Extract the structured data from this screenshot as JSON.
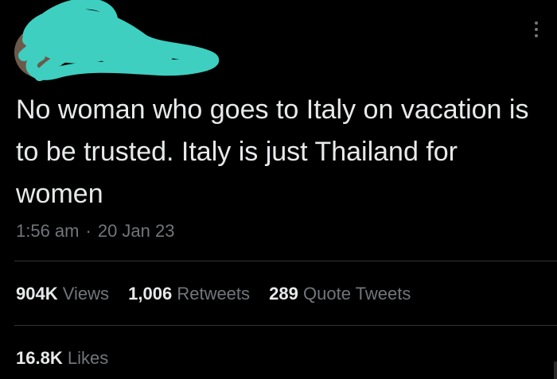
{
  "tweet": {
    "text": "No woman who goes to Italy on vacation is to be trusted. Italy is just Thailand for women",
    "time": "1:56 am",
    "separator": "·",
    "date": "20 Jan 23"
  },
  "stats": {
    "views_count": "904K",
    "views_label": "Views",
    "retweets_count": "1,006",
    "retweets_label": "Retweets",
    "quotes_count": "289",
    "quotes_label": "Quote Tweets",
    "likes_count": "16.8K",
    "likes_label": "Likes"
  },
  "colors": {
    "background": "#000000",
    "text": "#e7e9ea",
    "secondary": "#71767b",
    "divider": "#2f3336",
    "redaction": "#3ecfc0"
  },
  "icons": {
    "more": "more-vertical-icon"
  }
}
